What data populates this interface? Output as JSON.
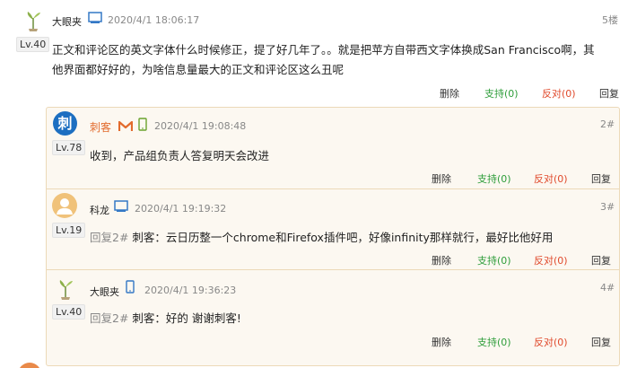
{
  "main_comment": {
    "username": "大眼夹",
    "time": "2020/4/1 18:06:17",
    "floor": "5楼",
    "level": "Lv.40",
    "text_line1": "正文和评论区的英文字体什么时候修正，提了好几年了。。就是把苹方自带西文字体换成San Francisco啊，其",
    "text_line2": "他界面都好好的，为啥信息量最大的正文和评论区这么丑呢",
    "actions": {
      "delete": "删除",
      "support": "支持(0)",
      "oppose": "反对(0)",
      "reply": "回复"
    }
  },
  "replies": [
    {
      "username": "刺客",
      "avatar_char": "刺",
      "time": "2020/4/1 19:08:48",
      "floor": "2#",
      "level": "Lv.78",
      "text": "收到，产品组负责人答复明天会改进",
      "actions": {
        "delete": "删除",
        "support": "支持(0)",
        "oppose": "反对(0)",
        "reply": "回复"
      }
    },
    {
      "username": "科龙",
      "time": "2020/4/1 19:19:32",
      "floor": "3#",
      "level": "Lv.19",
      "reply_prefix": "回复2#",
      "text": " 刺客：云日历整一个chrome和Firefox插件吧，好像infinity那样就行，最好比他好用",
      "actions": {
        "delete": "删除",
        "support": "支持(0)",
        "oppose": "反对(0)",
        "reply": "回复"
      }
    },
    {
      "username": "大眼夹",
      "time": "2020/4/1 19:36:23",
      "floor": "4#",
      "level": "Lv.40",
      "reply_prefix": "回复2#",
      "text": " 刺客：好的 谢谢刺客!",
      "actions": {
        "delete": "删除",
        "support": "支持(0)",
        "oppose": "反对(0)",
        "reply": "回复"
      }
    }
  ],
  "icons": {
    "desktop": "desktop-icon",
    "mobile": "mobile-icon",
    "gmail": "gmail-m-icon",
    "plant_avatar": "plant-avatar-icon",
    "user_avatar": "user-silhouette-icon"
  },
  "colors": {
    "support": "#2e9d3a",
    "oppose": "#e04a2c",
    "username_highlight": "#e26a2c",
    "quote_bg": "#fcf8f1",
    "quote_border": "#ecd9b8"
  }
}
